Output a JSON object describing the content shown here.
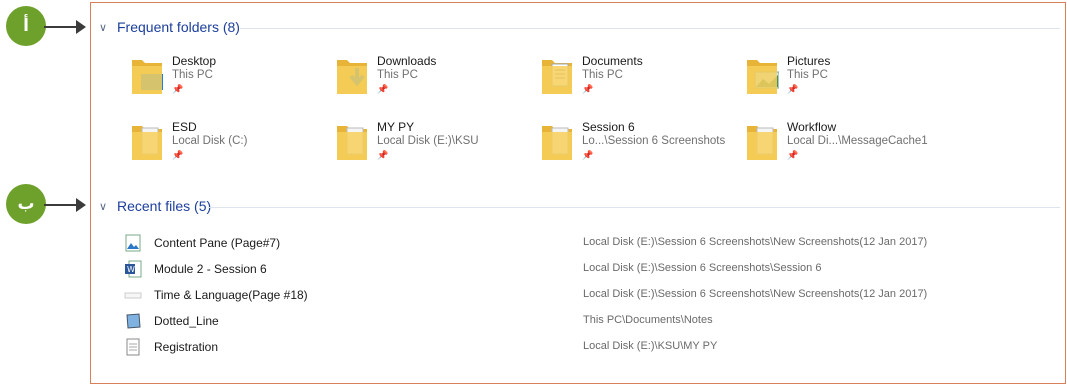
{
  "markers": {
    "a": "أ",
    "b": "ب"
  },
  "frequent": {
    "title": "Frequent folders (8)",
    "items": [
      {
        "name": "Desktop",
        "location": "This PC",
        "icon": "desktop-folder-icon"
      },
      {
        "name": "Downloads",
        "location": "This PC",
        "icon": "downloads-folder-icon"
      },
      {
        "name": "Documents",
        "location": "This PC",
        "icon": "documents-folder-icon"
      },
      {
        "name": "Pictures",
        "location": "This PC",
        "icon": "pictures-folder-icon"
      },
      {
        "name": "ESD",
        "location": "Local Disk (C:)",
        "icon": "folder-icon"
      },
      {
        "name": "MY PY",
        "location": "Local Disk (E:)\\KSU",
        "icon": "folder-icon"
      },
      {
        "name": "Session 6",
        "location": "Lo...\\Session 6 Screenshots",
        "icon": "folder-icon"
      },
      {
        "name": "Workflow",
        "location": "Local Di...\\MessageCache1",
        "icon": "folder-icon"
      }
    ]
  },
  "recent": {
    "title": "Recent files (5)",
    "items": [
      {
        "name": "Content Pane (Page#7)",
        "path": "Local Disk (E:)\\Session 6 Screenshots\\New Screenshots(12 Jan 2017)",
        "icon": "image-file-icon"
      },
      {
        "name": "Module 2 - Session 6",
        "path": "Local Disk (E:)\\Session 6 Screenshots\\Session 6",
        "icon": "word-file-icon"
      },
      {
        "name": "Time & Language(Page #18)",
        "path": "Local Disk (E:)\\Session 6 Screenshots\\New Screenshots(12 Jan 2017)",
        "icon": "blank-file-icon"
      },
      {
        "name": "Dotted_Line",
        "path": "This PC\\Documents\\Notes",
        "icon": "notes-file-icon"
      },
      {
        "name": "Registration",
        "path": "Local Disk (E:)\\KSU\\MY PY",
        "icon": "text-file-icon"
      }
    ]
  },
  "colors": {
    "header": "#1c3f9c",
    "folder": "#f4c548",
    "marker": "#6ea12b",
    "frame": "#d9805a"
  }
}
